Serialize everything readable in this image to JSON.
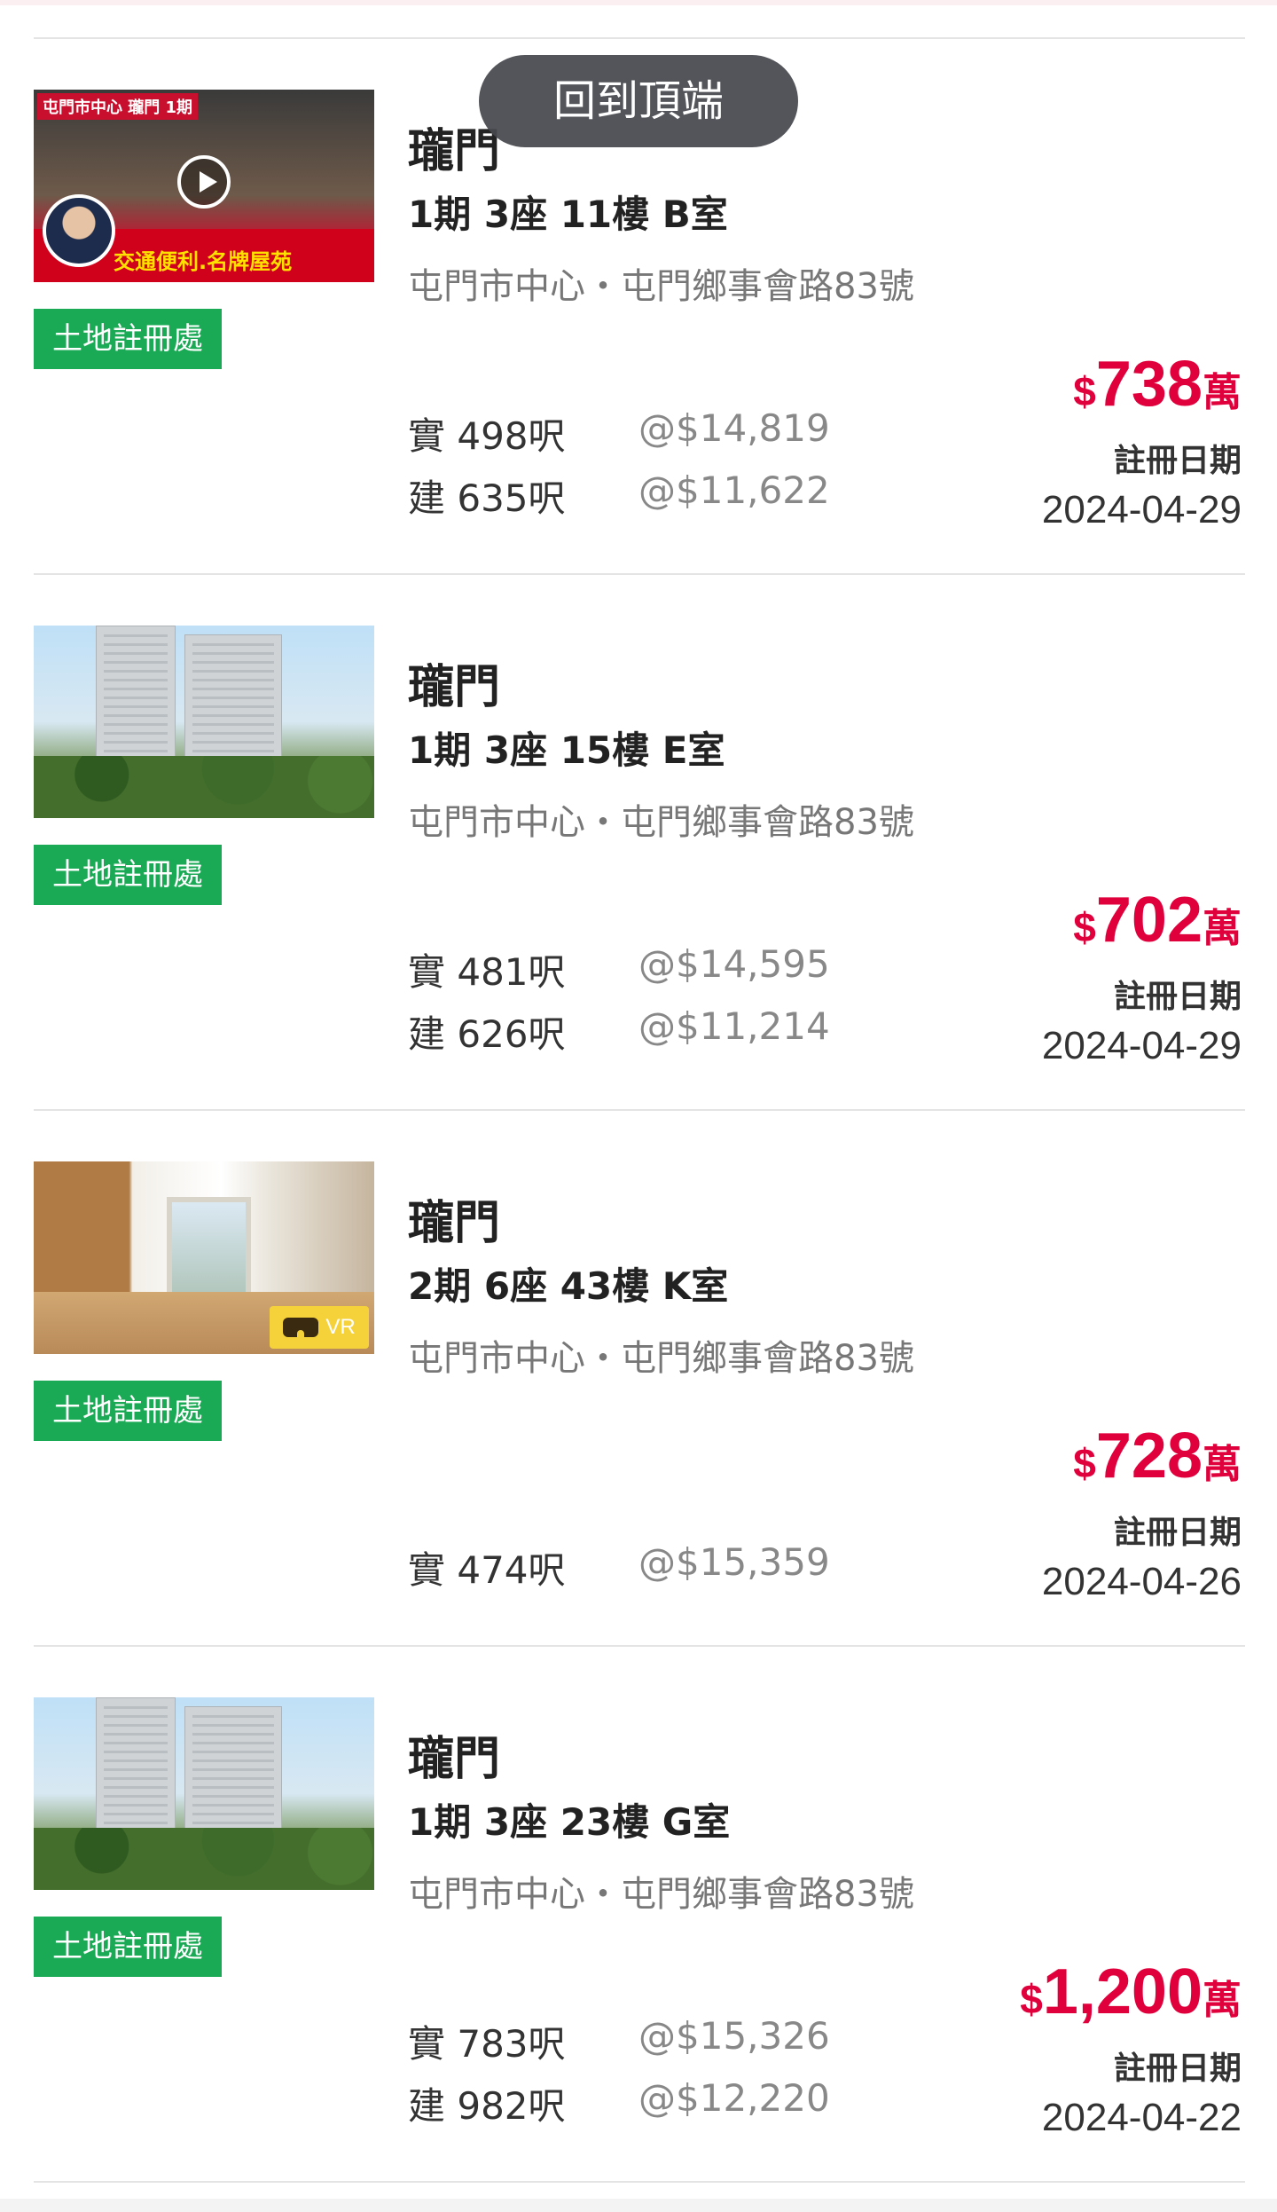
{
  "back_to_top_label": "回到頂端",
  "accent_color": "#e0003c",
  "badge_color": "#1aaa55",
  "listings": [
    {
      "thumbnail": "video-thumbnail",
      "video_tag": "屯門市中心 瓏門 1期",
      "video_caption": "交通便利.名牌屋苑",
      "badge": "土地註冊處",
      "name": "瓏門",
      "unit": "1期 3座 11樓 B室",
      "location": "屯門市中心・屯門鄉事會路83號",
      "saleable": "實 498呎",
      "saleable_price": "@$14,819",
      "gross": "建 635呎",
      "gross_price": "@$11,622",
      "price_currency": "$",
      "price_amount": "738",
      "price_unit": "萬",
      "reg_label": "註冊日期",
      "reg_date": "2024-04-29"
    },
    {
      "thumbnail": "tower-photo",
      "badge": "土地註冊處",
      "name": "瓏門",
      "unit": "1期 3座 15樓 E室",
      "location": "屯門市中心・屯門鄉事會路83號",
      "saleable": "實 481呎",
      "saleable_price": "@$14,595",
      "gross": "建 626呎",
      "gross_price": "@$11,214",
      "price_currency": "$",
      "price_amount": "702",
      "price_unit": "萬",
      "reg_label": "註冊日期",
      "reg_date": "2024-04-29"
    },
    {
      "thumbnail": "room-photo",
      "vr_label": "VR",
      "badge": "土地註冊處",
      "name": "瓏門",
      "unit": "2期 6座 43樓 K室",
      "location": "屯門市中心・屯門鄉事會路83號",
      "saleable": "實 474呎",
      "saleable_price": "@$15,359",
      "price_currency": "$",
      "price_amount": "728",
      "price_unit": "萬",
      "reg_label": "註冊日期",
      "reg_date": "2024-04-26"
    },
    {
      "thumbnail": "tower-photo",
      "badge": "土地註冊處",
      "name": "瓏門",
      "unit": "1期 3座 23樓 G室",
      "location": "屯門市中心・屯門鄉事會路83號",
      "saleable": "實 783呎",
      "saleable_price": "@$15,326",
      "gross": "建 982呎",
      "gross_price": "@$12,220",
      "price_currency": "$",
      "price_amount": "1,200",
      "price_unit": "萬",
      "reg_label": "註冊日期",
      "reg_date": "2024-04-22"
    }
  ]
}
